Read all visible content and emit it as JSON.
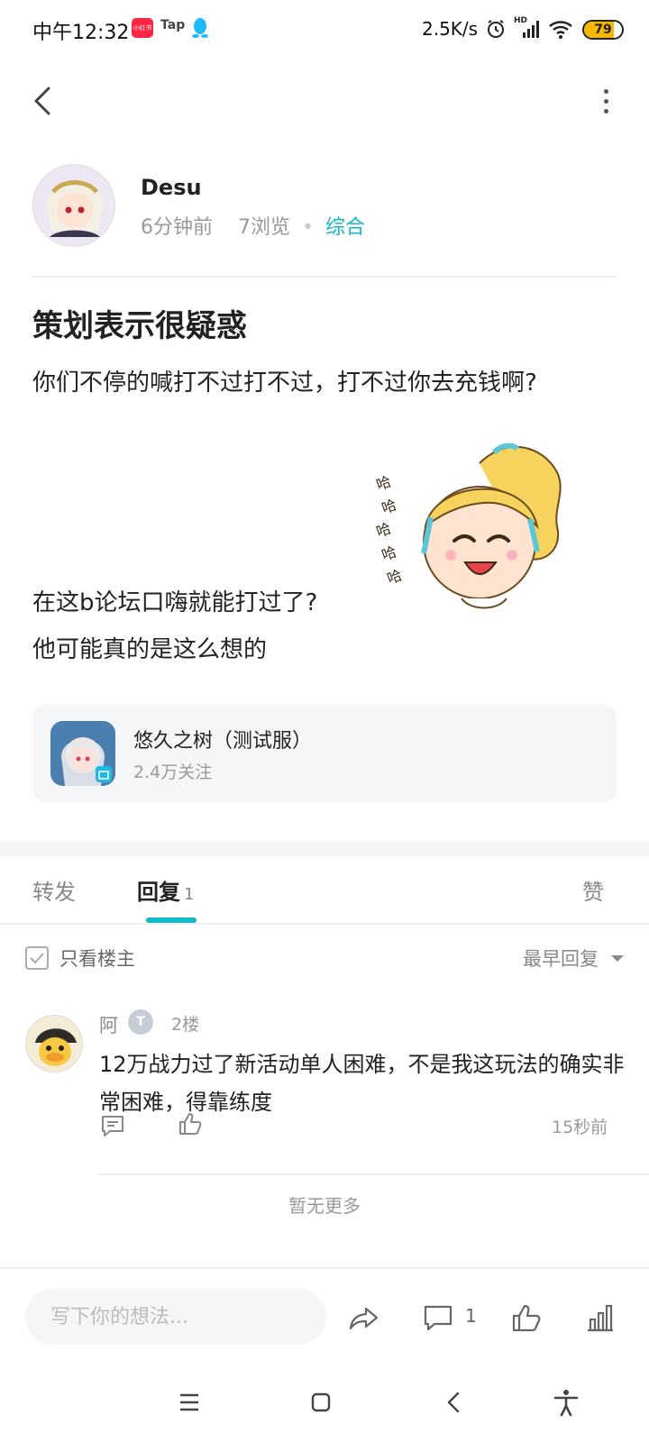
{
  "status_bar": {
    "time": "中午12:32",
    "app1": "小红书",
    "app2": "Tap",
    "speed": "2.5K/s",
    "network_badge": "HD",
    "battery": "79",
    "battery_level": 0.79
  },
  "author": {
    "name": "Desu",
    "time_ago": "6分钟前",
    "views": "7浏览",
    "category": "综合"
  },
  "post": {
    "title": "策划表示很疑惑",
    "body_line1": "你们不停的喊打不过打不过，打不过你去充钱啊?",
    "body_line2": "在这b论坛口嗨就能打过了?",
    "body_line3": "他可能真的是这么想的"
  },
  "game": {
    "name": "悠久之树（测试服）",
    "followers": "2.4万关注"
  },
  "tabs": {
    "repost": "转发",
    "reply": "回复",
    "reply_count": "1",
    "like": "赞"
  },
  "filter": {
    "only_op": "只看楼主",
    "sort": "最早回复"
  },
  "reply": {
    "user": "阿",
    "badge": "T",
    "floor": "2楼",
    "text": "12万战力过了新活动单人困难，不是我这玩法的确实非常困难，得靠练度",
    "time": "15秒前"
  },
  "no_more": "暂无更多",
  "bottom_bar": {
    "placeholder": "写下你的想法...",
    "comment_count": "1"
  },
  "colors": {
    "accent": "#14b9c8",
    "muted": "#999999"
  }
}
